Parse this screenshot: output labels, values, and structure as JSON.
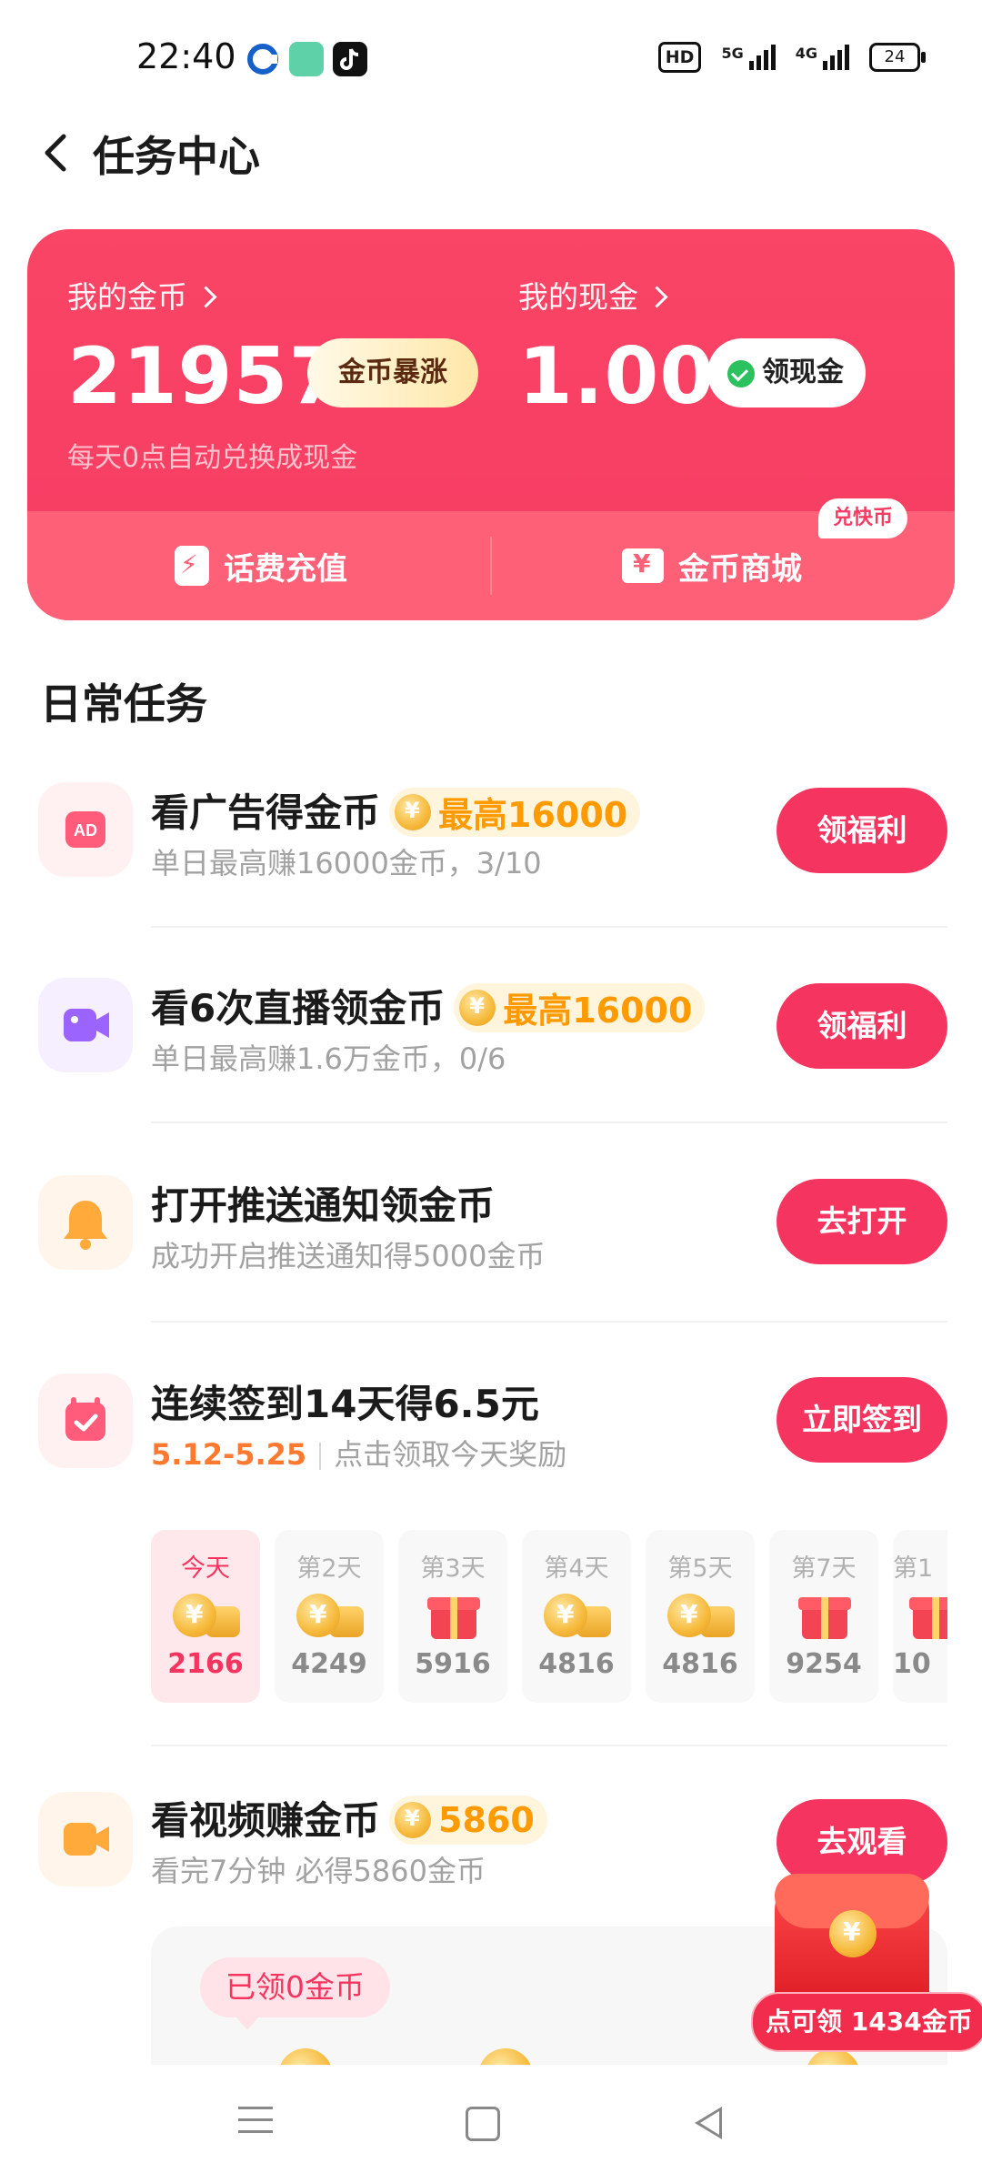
{
  "status_bar": {
    "time": "22:40",
    "network_1": "5G",
    "network_2": "4G",
    "hd": "HD",
    "battery": "24"
  },
  "header": {
    "title": "任务中心"
  },
  "wallet": {
    "coins_label": "我的金币",
    "coins_value": "21957",
    "coins_badge": "金币暴涨",
    "cash_label": "我的现金",
    "cash_value": "1.00",
    "cash_button": "领现金",
    "hint": "每天0点自动兑换成现金",
    "recharge_label": "话费充值",
    "mall_label": "金币商城",
    "mall_badge": "兑快币"
  },
  "section_title": "日常任务",
  "tasks": [
    {
      "title": "看广告得金币",
      "tag": "最高16000",
      "desc": "单日最高赚16000金币，3/10",
      "button": "领福利",
      "icon": "ad-icon",
      "icon_bg": "#fff0f2",
      "icon_color": "#ff5b7a"
    },
    {
      "title": "看6次直播领金币",
      "tag": "最高16000",
      "desc": "单日最高赚1.6万金币，0/6",
      "button": "领福利",
      "icon": "live-camera-icon",
      "icon_bg": "#f5efff",
      "icon_color": "#9b63ff"
    },
    {
      "title": "打开推送通知领金币",
      "desc": "成功开启推送通知得5000金币",
      "button": "去打开",
      "icon": "bell-icon",
      "icon_bg": "#fff5ea",
      "icon_color": "#ffaa3a"
    },
    {
      "title": "连续签到14天得6.5元",
      "range": "5.12-5.25",
      "desc": "点击领取今天奖励",
      "button": "立即签到",
      "icon": "calendar-icon",
      "icon_bg": "#fff0f2",
      "icon_color": "#ff5b7a"
    },
    {
      "title": "看视频赚金币",
      "tag": "5860",
      "desc": "看完7分钟 必得5860金币",
      "button": "去观看",
      "icon": "video-icon",
      "icon_bg": "#fff5ea",
      "icon_color": "#ffaa3a"
    }
  ],
  "checkin_days": [
    {
      "label": "今天",
      "value": "2166",
      "reward": "coins",
      "today": true
    },
    {
      "label": "第2天",
      "value": "4249",
      "reward": "coins"
    },
    {
      "label": "第3天",
      "value": "5916",
      "reward": "gift"
    },
    {
      "label": "第4天",
      "value": "4816",
      "reward": "coins"
    },
    {
      "label": "第5天",
      "value": "4816",
      "reward": "coins"
    },
    {
      "label": "第7天",
      "value": "9254",
      "reward": "gift"
    },
    {
      "label": "第1",
      "value": "10",
      "reward": "gift"
    }
  ],
  "video_panel": {
    "collected": "已领0金币"
  },
  "float_reward": {
    "label": "点可领 1434金币"
  },
  "colors": {
    "primary": "#f53560",
    "wallet_bg": "#f63b62",
    "accent_orange": "#ff9a00"
  }
}
